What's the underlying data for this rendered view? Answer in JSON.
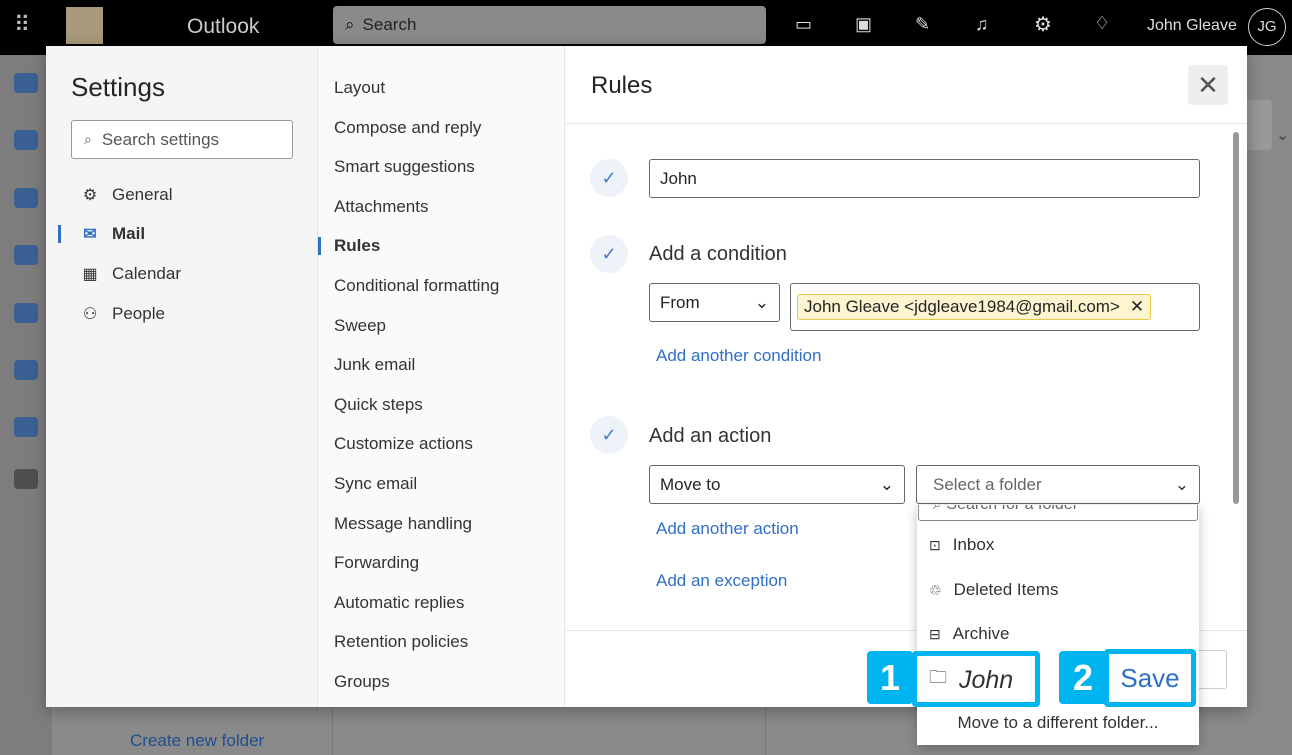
{
  "topbar": {
    "app_name": "Outlook",
    "search_placeholder": "Search",
    "user_name": "John Gleave",
    "avatar_initials": "JG"
  },
  "background": {
    "create_folder_link": "Create new folder"
  },
  "settings": {
    "title": "Settings",
    "search_placeholder": "Search settings",
    "categories": [
      {
        "label": "General",
        "icon": "gear-icon"
      },
      {
        "label": "Mail",
        "icon": "mail-icon",
        "active": true
      },
      {
        "label": "Calendar",
        "icon": "calendar-icon"
      },
      {
        "label": "People",
        "icon": "people-icon"
      }
    ],
    "mail_sections": [
      "Layout",
      "Compose and reply",
      "Smart suggestions",
      "Attachments",
      "Rules",
      "Conditional formatting",
      "Sweep",
      "Junk email",
      "Quick steps",
      "Customize actions",
      "Sync email",
      "Message handling",
      "Forwarding",
      "Automatic replies",
      "Retention policies",
      "Groups"
    ],
    "active_section": "Rules"
  },
  "rules": {
    "title": "Rules",
    "rule_name": "John",
    "condition_heading": "Add a condition",
    "condition_type": "From",
    "condition_value": "John Gleave <jdgleave1984@gmail.com>",
    "add_condition": "Add another condition",
    "action_heading": "Add an action",
    "action_type": "Move to",
    "folder_placeholder": "Select a folder",
    "add_action": "Add another action",
    "add_exception": "Add an exception",
    "save_label": "Save"
  },
  "folder_dropdown": {
    "search_placeholder": "Search for a folder",
    "items": [
      {
        "label": "Inbox",
        "icon": "inbox-icon"
      },
      {
        "label": "Deleted Items",
        "icon": "trash-icon"
      },
      {
        "label": "Archive",
        "icon": "archive-icon"
      },
      {
        "label": "John",
        "icon": "folder-icon"
      }
    ],
    "more": "Move to a different folder..."
  },
  "annotations": {
    "step1": "1",
    "step2": "2"
  },
  "colors": {
    "accent": "#2f6fc6",
    "annotation": "#00b4f0"
  }
}
